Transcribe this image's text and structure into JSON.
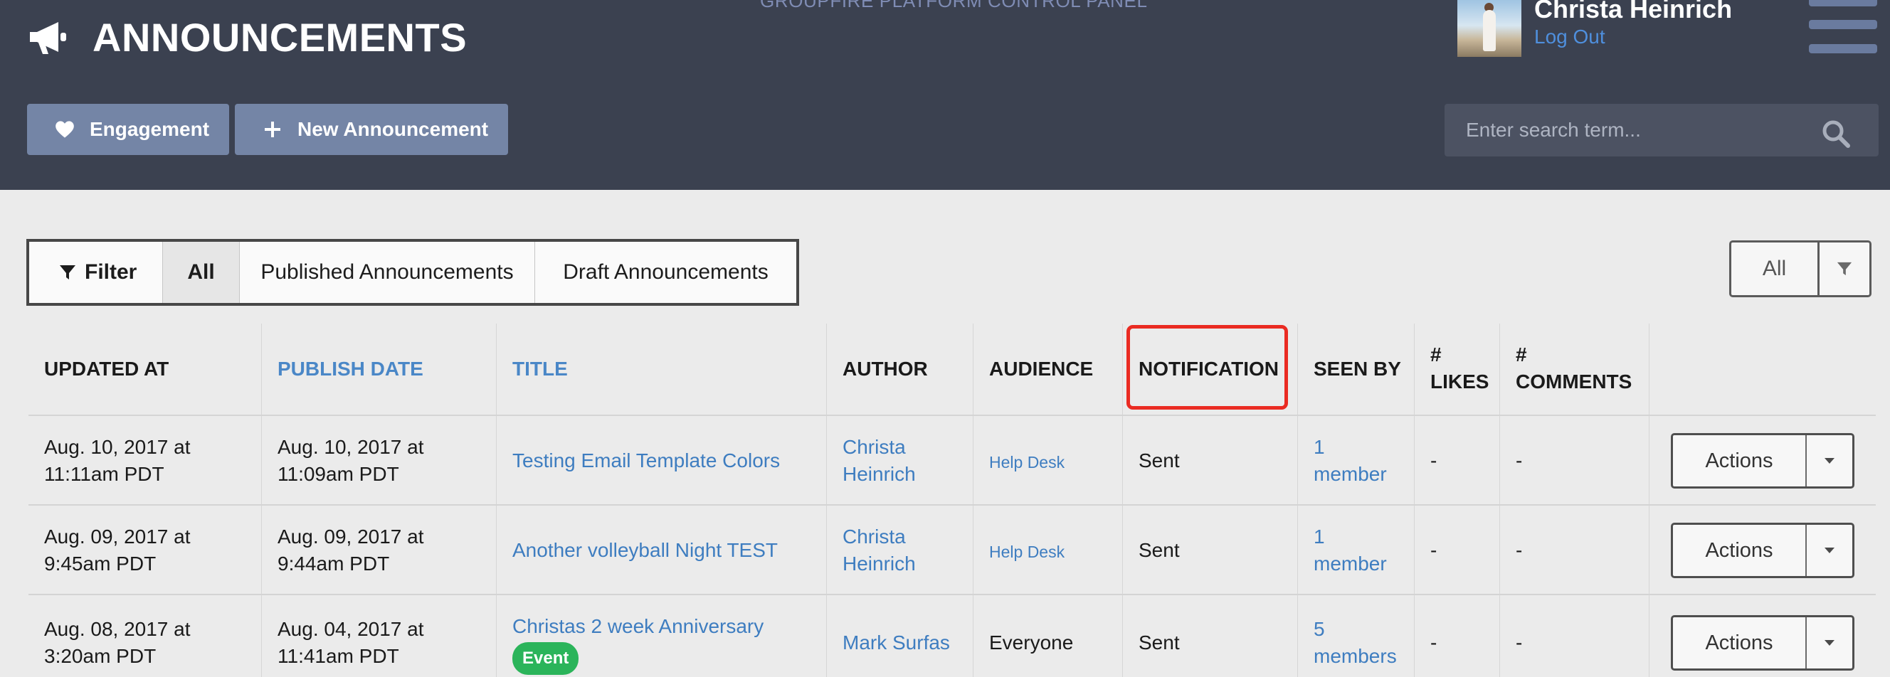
{
  "header": {
    "title": "ANNOUNCEMENTS",
    "title_icon": "megaphone-icon",
    "platform_label": "GROUPFIRE PLATFORM CONTROL PANEL",
    "user_name": "Christa Heinrich",
    "logout_label": "Log Out",
    "engagement_label": "Engagement",
    "engagement_icon": "heart-icon",
    "new_announcement_label": "New Announcement",
    "new_announcement_icon": "plus-icon",
    "search_placeholder": "Enter search term...",
    "search_icon": "search-icon",
    "menu_icon": "hamburger-menu-icon"
  },
  "filter_bar": {
    "filter_label": "Filter",
    "all_label": "All",
    "published_label": "Published Announcements",
    "draft_label": "Draft Announcements",
    "selected": "All"
  },
  "right_filter": {
    "label": "All",
    "icon": "funnel-icon"
  },
  "table": {
    "columns": [
      {
        "lines": [
          "UPDATED AT"
        ],
        "sortable": false
      },
      {
        "lines": [
          "PUBLISH DATE"
        ],
        "sortable": true
      },
      {
        "lines": [
          "TITLE"
        ],
        "sortable": true
      },
      {
        "lines": [
          "AUTHOR"
        ],
        "sortable": false
      },
      {
        "lines": [
          "AUDIENCE"
        ],
        "sortable": false
      },
      {
        "lines": [
          "NOTIFICATION"
        ],
        "sortable": false
      },
      {
        "lines": [
          "SEEN BY"
        ],
        "sortable": false
      },
      {
        "lines": [
          "#",
          "LIKES"
        ],
        "sortable": false
      },
      {
        "lines": [
          "#",
          "COMMENTS"
        ],
        "sortable": false
      }
    ],
    "rows": [
      {
        "updated_at": [
          "Aug. 10, 2017 at",
          "11:11am PDT"
        ],
        "publish_date": [
          "Aug. 10, 2017 at",
          "11:09am PDT"
        ],
        "title": "Testing Email Template Colors",
        "badge": "",
        "author": [
          "Christa",
          "Heinrich"
        ],
        "audience": "Help Desk",
        "notification": "Sent",
        "seen_by": [
          "1",
          "member"
        ],
        "likes": "-",
        "comments": "-",
        "actions_label": "Actions"
      },
      {
        "updated_at": [
          "Aug. 09, 2017 at",
          "9:45am PDT"
        ],
        "publish_date": [
          "Aug. 09, 2017 at",
          "9:44am PDT"
        ],
        "title": "Another volleyball Night TEST",
        "badge": "",
        "author": [
          "Christa",
          "Heinrich"
        ],
        "audience": "Help Desk",
        "notification": "Sent",
        "seen_by": [
          "1",
          "member"
        ],
        "likes": "-",
        "comments": "-",
        "actions_label": "Actions"
      },
      {
        "updated_at": [
          "Aug. 08, 2017 at",
          "3:20am PDT"
        ],
        "publish_date": [
          "Aug. 04, 2017 at",
          "11:41am PDT"
        ],
        "title": "Christas 2 week Anniversary",
        "badge": "Event",
        "author": [
          "Mark Surfas"
        ],
        "audience": "Everyone",
        "notification": "Sent",
        "seen_by": [
          "5",
          "members"
        ],
        "likes": "-",
        "comments": "-",
        "actions_label": "Actions"
      }
    ]
  },
  "highlight_target": "NOTIFICATION",
  "colors": {
    "header_bg": "#3b4150",
    "header_button": "#7485a6",
    "link": "#3e7dc0",
    "badge_event": "#2bb45a",
    "highlight": "#ea2b22",
    "page_bg": "#ebebeb"
  }
}
